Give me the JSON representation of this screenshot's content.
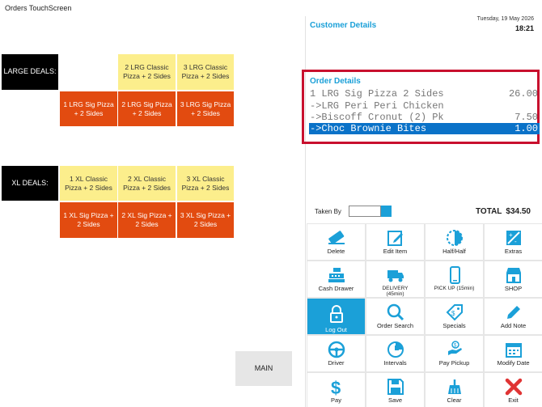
{
  "window": {
    "title": "Orders TouchScreen"
  },
  "deals": {
    "large_label": "LARGE DEALS:",
    "large_top": [
      "2 LRG Classic Pizza + 2 Sides",
      "3 LRG Classic Pizza + 2 Sides"
    ],
    "large_bottom": [
      "1 LRG Sig Pizza + 2 Sides",
      "2 LRG Sig Pizza + 2 Sides",
      "3 LRG Sig Pizza + 2 Sides"
    ],
    "xl_label": "XL DEALS:",
    "xl_top": [
      "1 XL Classic Pizza + 2 Sides",
      "2 XL Classic Pizza + 2 Sides",
      "3 XL Classic Pizza + 2 Sides"
    ],
    "xl_bottom": [
      "1 XL Sig Pizza + 2 Sides",
      "2 XL Sig Pizza + 2 Sides",
      "3 XL Sig Pizza + 2 Sides"
    ],
    "main_label": "MAIN"
  },
  "customer": {
    "title": "Customer Details"
  },
  "clock": {
    "date": "Tuesday, 19 May 2026",
    "time": "18:21"
  },
  "order": {
    "title": "Order Details",
    "lines": [
      {
        "text": "1 LRG Sig Pizza 2 Sides",
        "price": "26.00",
        "selected": false
      },
      {
        "text": "->LRG Peri Peri Chicken",
        "price": "",
        "selected": false
      },
      {
        "text": "->Biscoff Cronut (2) Pk",
        "price": "7.50",
        "selected": false
      },
      {
        "text": "->Choc Brownie Bites",
        "price": "1.00",
        "selected": true
      }
    ]
  },
  "taken_by": {
    "label": "Taken By",
    "value": ""
  },
  "total": {
    "label": "TOTAL",
    "value": "$34.50"
  },
  "actions": [
    {
      "label": "Delete",
      "icon": "eraser-icon"
    },
    {
      "label": "Edit Item",
      "icon": "edit-icon"
    },
    {
      "label": "Half/Half",
      "icon": "half-circle-icon"
    },
    {
      "label": "Extras",
      "icon": "extras-icon"
    },
    {
      "label": "Cash Drawer",
      "icon": "cash-register-icon"
    },
    {
      "label": "DELIVERY (45min)",
      "icon": "truck-icon"
    },
    {
      "label": "PICK UP (15min)",
      "icon": "phone-icon"
    },
    {
      "label": "SHOP",
      "icon": "shop-icon"
    },
    {
      "label": "Log Out",
      "icon": "lock-icon",
      "active": true
    },
    {
      "label": "Order Search",
      "icon": "search-icon"
    },
    {
      "label": "Specials",
      "icon": "tag-icon"
    },
    {
      "label": "Add Note",
      "icon": "pencil-icon"
    },
    {
      "label": "Driver",
      "icon": "steering-wheel-icon"
    },
    {
      "label": "Intervals",
      "icon": "timer-icon"
    },
    {
      "label": "Pay Pickup",
      "icon": "pay-hand-icon"
    },
    {
      "label": "Modify Date",
      "icon": "calendar-icon"
    },
    {
      "label": "Pay",
      "icon": "dollar-icon"
    },
    {
      "label": "Save",
      "icon": "save-icon"
    },
    {
      "label": "Clear",
      "icon": "clear-icon"
    },
    {
      "label": "Exit",
      "icon": "exit-icon"
    }
  ],
  "colors": {
    "accent": "#1ba0d8",
    "deal_yellow": "#fcee8c",
    "deal_red": "#e24b10",
    "highlight_box": "#c8102e",
    "selected_row": "#0a72c8",
    "exit_red": "#e03434"
  }
}
